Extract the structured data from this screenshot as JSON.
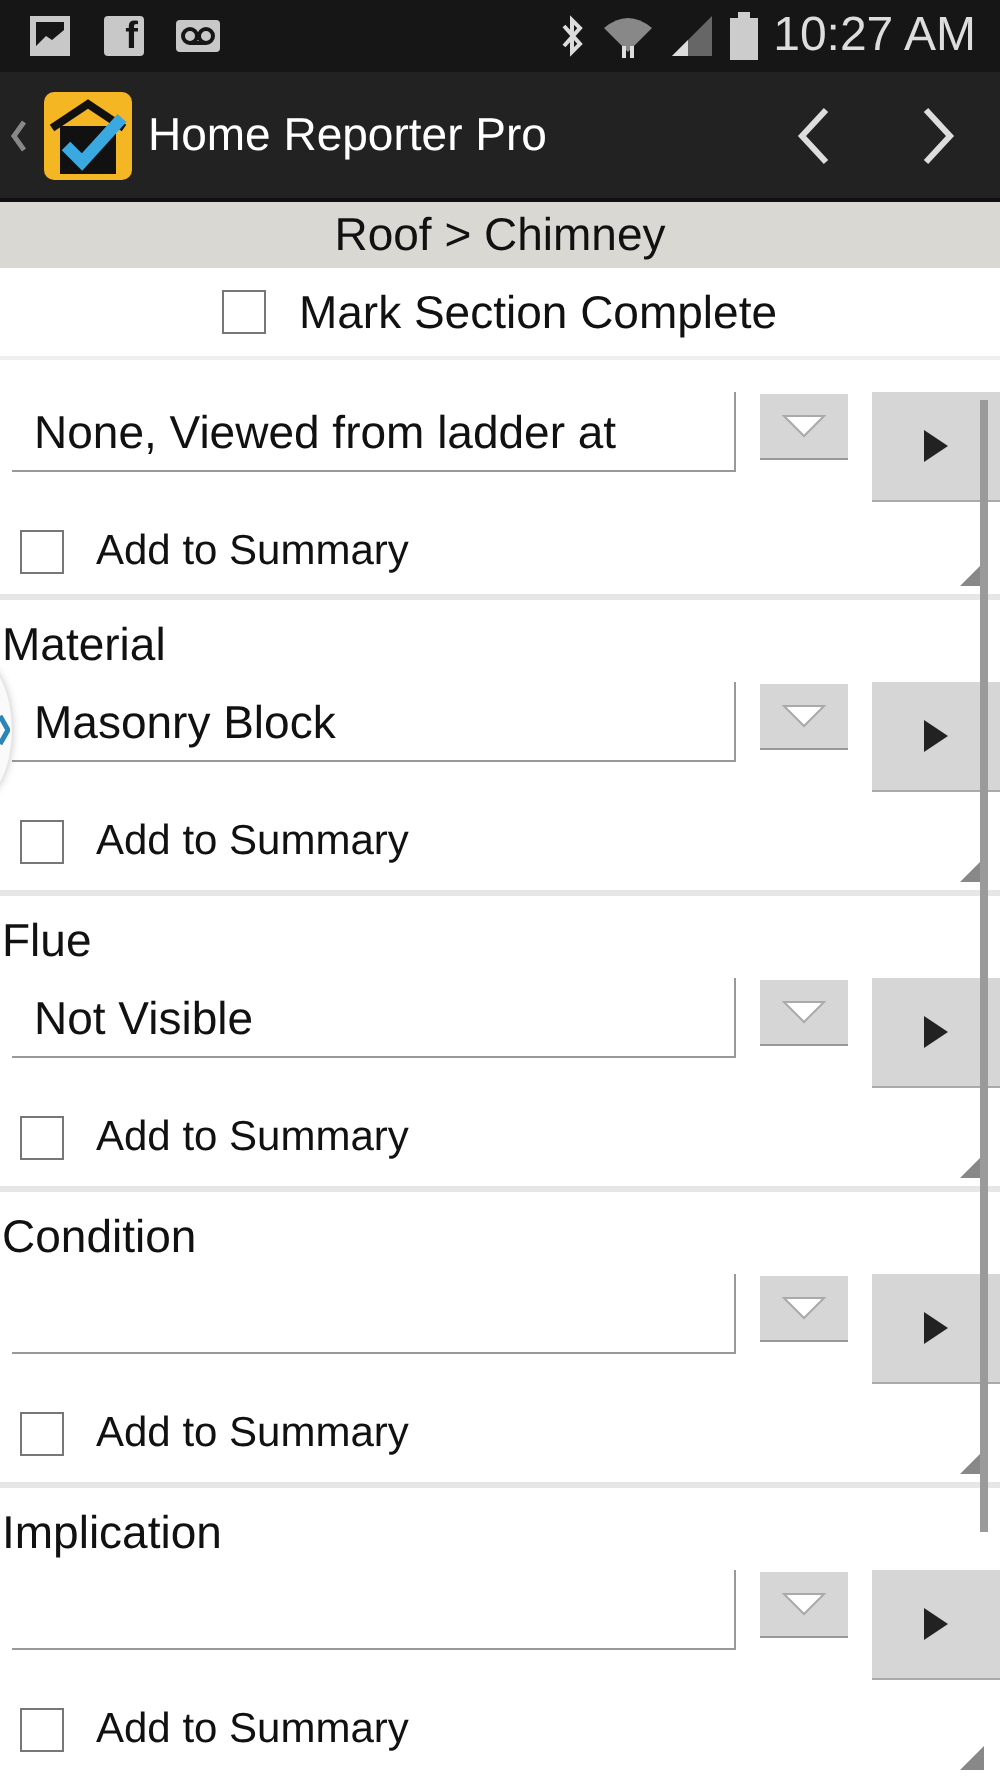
{
  "status_bar": {
    "notification_glyph": "f",
    "time": "10:27 AM"
  },
  "app_bar": {
    "title": "Home Reporter Pro"
  },
  "breadcrumb": "Roof > Chimney",
  "mark_complete": {
    "label": "Mark Section Complete",
    "checked": false
  },
  "side_drawer_handle": true,
  "sections": [
    {
      "value": "None, Viewed from ladder at",
      "summary": {
        "label": "Add to Summary",
        "checked": false
      }
    },
    {
      "label": "Material",
      "value": "Masonry Block",
      "summary": {
        "label": "Add to Summary",
        "checked": false
      }
    },
    {
      "label": "Flue",
      "value": "Not Visible",
      "summary": {
        "label": "Add to Summary",
        "checked": false
      }
    },
    {
      "label": "Condition",
      "summary": {
        "label": "Add to Summary",
        "checked": false
      }
    },
    {
      "label": "Implication",
      "summary": {
        "label": "Add to Summary",
        "checked": false
      }
    }
  ]
}
